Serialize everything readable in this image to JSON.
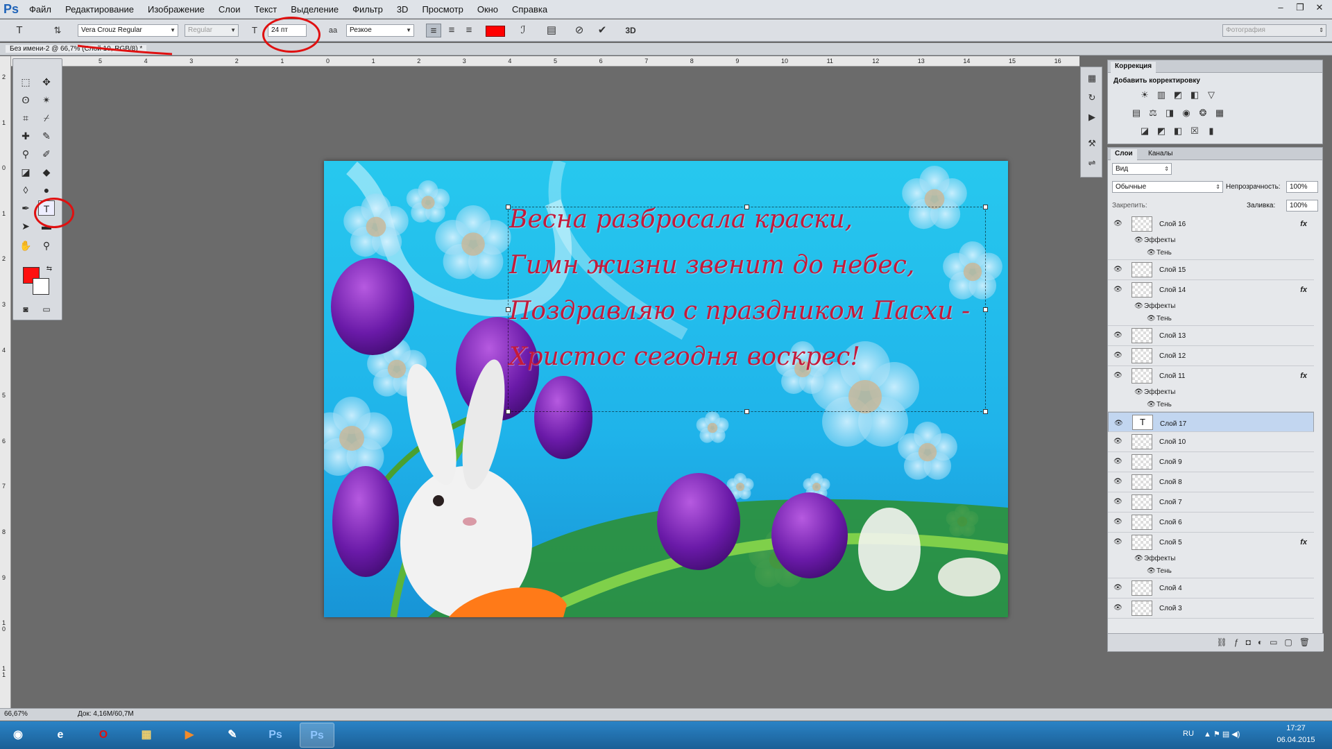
{
  "app": {
    "logo": "Ps"
  },
  "menu": [
    "Файл",
    "Редактирование",
    "Изображение",
    "Слои",
    "Текст",
    "Выделение",
    "Фильтр",
    "3D",
    "Просмотр",
    "Окно",
    "Справка"
  ],
  "options": {
    "font_family": "Vera Crouz Regular",
    "font_style": "Regular",
    "font_size": "24 пт",
    "aa_label": "aa",
    "antialias": "Резкое",
    "text_color": "#ff0000",
    "btn_3d": "3D",
    "workspace": "Фотография"
  },
  "document": {
    "tab": "Без имени-2 @ 66,7% (Слой 10, RGB/8) *"
  },
  "rulers": {
    "h": [
      "5",
      "4",
      "3",
      "2",
      "1",
      "0",
      "1",
      "2",
      "3",
      "4",
      "5",
      "6",
      "7",
      "8",
      "9",
      "10",
      "11",
      "12",
      "13",
      "14",
      "15",
      "16"
    ],
    "v": [
      "2",
      "1",
      "0",
      "1",
      "2",
      "3",
      "4",
      "5",
      "6",
      "7",
      "8",
      "9",
      "1\n0",
      "1\n1"
    ]
  },
  "canvas": {
    "poem": [
      "Весна разбросала краски,",
      "Гимн жизни звенит до небес,",
      "Поздравляю с праздником Пасхи -",
      "Христос сегодня воскрес!"
    ]
  },
  "adjustments": {
    "tab": "Коррекция",
    "heading": "Добавить корректировку"
  },
  "layers_panel": {
    "tabs": [
      "Слои",
      "Каналы"
    ],
    "filter": "Вид",
    "blend_mode": "Обычные",
    "opacity_label": "Непрозрачность:",
    "opacity": "100%",
    "lock_label": "Закрепить:",
    "fill_label": "Заливка:",
    "fill": "100%",
    "effects_label": "Эффекты",
    "shadow_label": "Тень",
    "fx": "fx",
    "layers": [
      {
        "name": "Слой 16",
        "fx": true
      },
      {
        "name": "Слой 15",
        "fx": false
      },
      {
        "name": "Слой 14",
        "fx": true
      },
      {
        "name": "Слой 13",
        "fx": false
      },
      {
        "name": "Слой 12",
        "fx": false
      },
      {
        "name": "Слой 11",
        "fx": true
      },
      {
        "name": "Слой 17",
        "fx": false,
        "selected": true,
        "text": true
      },
      {
        "name": "Слой 10",
        "fx": false
      },
      {
        "name": "Слой 9",
        "fx": false
      },
      {
        "name": "Слой 8",
        "fx": false
      },
      {
        "name": "Слой 7",
        "fx": false
      },
      {
        "name": "Слой 6",
        "fx": false
      },
      {
        "name": "Слой 5",
        "fx": true
      },
      {
        "name": "Слой 4",
        "fx": false
      },
      {
        "name": "Слой 3",
        "fx": false
      }
    ]
  },
  "status": {
    "zoom": "66,67%",
    "doc": "Док: 4,16M/60,7M"
  },
  "taskbar": {
    "lang": "RU",
    "time": "17:27",
    "date": "06.04.2015",
    "ps_label": "Ps"
  }
}
